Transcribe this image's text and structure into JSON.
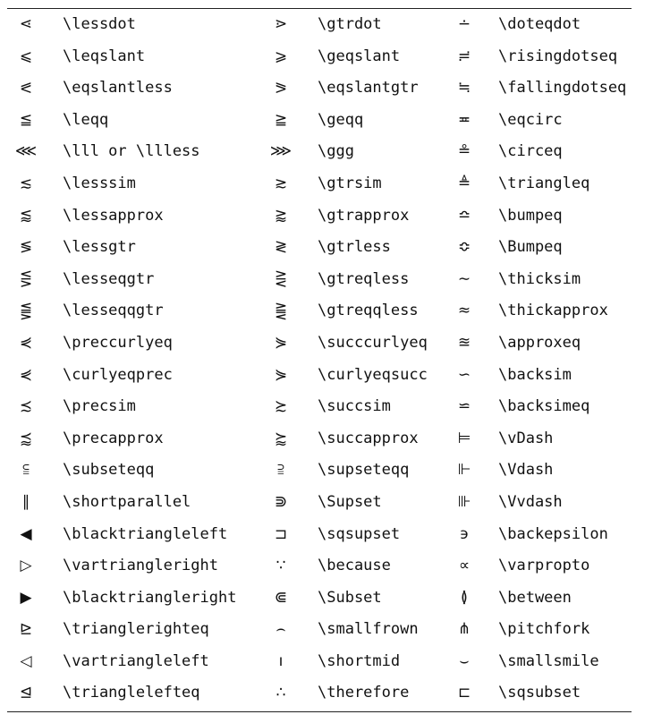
{
  "rows": [
    [
      {
        "s": "⋖",
        "c": "\\lessdot"
      },
      {
        "s": "⋗",
        "c": "\\gtrdot"
      },
      {
        "s": "∸",
        "c": "\\doteqdot"
      }
    ],
    [
      {
        "s": "⩽",
        "c": "\\leqslant"
      },
      {
        "s": "⩾",
        "c": "\\geqslant"
      },
      {
        "s": "≓",
        "c": "\\risingdotseq"
      }
    ],
    [
      {
        "s": "⪕",
        "c": "\\eqslantless"
      },
      {
        "s": "⪖",
        "c": "\\eqslantgtr"
      },
      {
        "s": "≒",
        "c": "\\fallingdotseq"
      }
    ],
    [
      {
        "s": "≦",
        "c": "\\leqq"
      },
      {
        "s": "≧",
        "c": "\\geqq"
      },
      {
        "s": "≖",
        "c": "\\eqcirc"
      }
    ],
    [
      {
        "s": "⋘",
        "c": "\\lll or \\llless"
      },
      {
        "s": "⋙",
        "c": "\\ggg"
      },
      {
        "s": "≗",
        "c": "\\circeq"
      }
    ],
    [
      {
        "s": "≲",
        "c": "\\lesssim"
      },
      {
        "s": "≳",
        "c": "\\gtrsim"
      },
      {
        "s": "≜",
        "c": "\\triangleq"
      }
    ],
    [
      {
        "s": "⪅",
        "c": "\\lessapprox"
      },
      {
        "s": "⪆",
        "c": "\\gtrapprox"
      },
      {
        "s": "≏",
        "c": "\\bumpeq"
      }
    ],
    [
      {
        "s": "≶",
        "c": "\\lessgtr"
      },
      {
        "s": "≷",
        "c": "\\gtrless"
      },
      {
        "s": "≎",
        "c": "\\Bumpeq"
      }
    ],
    [
      {
        "s": "⋚",
        "c": "\\lesseqgtr"
      },
      {
        "s": "⋛",
        "c": "\\gtreqless"
      },
      {
        "s": "∼",
        "c": "\\thicksim"
      }
    ],
    [
      {
        "s": "⪋",
        "c": "\\lesseqqgtr"
      },
      {
        "s": "⪌",
        "c": "\\gtreqqless"
      },
      {
        "s": "≈",
        "c": "\\thickapprox"
      }
    ],
    [
      {
        "s": "⋞",
        "c": "\\preccurlyeq"
      },
      {
        "s": "⋟",
        "c": "\\succcurlyeq"
      },
      {
        "s": "≊",
        "c": "\\approxeq"
      }
    ],
    [
      {
        "s": "⋞",
        "c": "\\curlyeqprec"
      },
      {
        "s": "⋟",
        "c": "\\curlyeqsucc"
      },
      {
        "s": "∽",
        "c": "\\backsim"
      }
    ],
    [
      {
        "s": "≾",
        "c": "\\precsim"
      },
      {
        "s": "≿",
        "c": "\\succsim"
      },
      {
        "s": "⋍",
        "c": "\\backsimeq"
      }
    ],
    [
      {
        "s": "⪷",
        "c": "\\precapprox"
      },
      {
        "s": "⪸",
        "c": "\\succapprox"
      },
      {
        "s": "⊨",
        "c": "\\vDash"
      }
    ],
    [
      {
        "s": "⫅",
        "c": "\\subseteqq"
      },
      {
        "s": "⫆",
        "c": "\\supseteqq"
      },
      {
        "s": "⊩",
        "c": "\\Vdash"
      }
    ],
    [
      {
        "s": "∥",
        "c": "\\shortparallel"
      },
      {
        "s": "⋑",
        "c": "\\Supset"
      },
      {
        "s": "⊪",
        "c": "\\Vvdash"
      }
    ],
    [
      {
        "s": "◀",
        "c": "\\blacktriangleleft"
      },
      {
        "s": "⊐",
        "c": "\\sqsupset"
      },
      {
        "s": "϶",
        "c": "\\backepsilon"
      }
    ],
    [
      {
        "s": "▷",
        "c": "\\vartriangleright"
      },
      {
        "s": "∵",
        "c": "\\because"
      },
      {
        "s": "∝",
        "c": "\\varpropto"
      }
    ],
    [
      {
        "s": "▶",
        "c": "\\blacktriangleright"
      },
      {
        "s": "⋐",
        "c": "\\Subset"
      },
      {
        "s": "≬",
        "c": "\\between"
      }
    ],
    [
      {
        "s": "⊵",
        "c": "\\trianglerighteq"
      },
      {
        "s": "⌢",
        "c": "\\smallfrown"
      },
      {
        "s": "⋔",
        "c": "\\pitchfork"
      }
    ],
    [
      {
        "s": "◁",
        "c": "\\vartriangleleft"
      },
      {
        "s": "ı",
        "c": "\\shortmid"
      },
      {
        "s": "⌣",
        "c": "\\smallsmile"
      }
    ],
    [
      {
        "s": "⊴",
        "c": "\\trianglelefteq"
      },
      {
        "s": "∴",
        "c": "\\therefore"
      },
      {
        "s": "⊏",
        "c": "\\sqsubset"
      }
    ]
  ]
}
